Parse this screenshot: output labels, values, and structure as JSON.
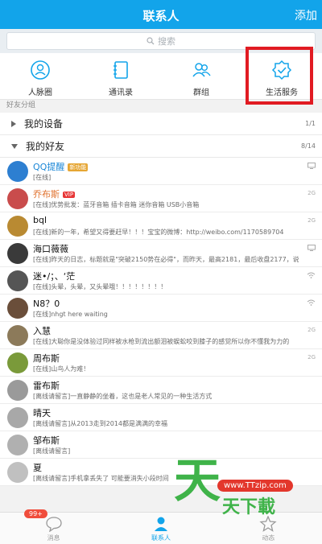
{
  "header": {
    "title": "联系人",
    "add_label": "添加"
  },
  "search": {
    "placeholder": "搜索"
  },
  "quick_entries": [
    {
      "label": "人脉圈",
      "icon": "people-circle-icon"
    },
    {
      "label": "通讯录",
      "icon": "address-book-icon"
    },
    {
      "label": "群组",
      "icon": "group-icon"
    },
    {
      "label": "生活服务",
      "icon": "shield-check-icon"
    }
  ],
  "group_label": "好友分组",
  "sections": [
    {
      "name": "我的设备",
      "count": "1/1",
      "expanded": false
    },
    {
      "name": "我的好友",
      "count": "8/14",
      "expanded": true
    }
  ],
  "contacts": [
    {
      "name": "QQ提醒",
      "badge": "新功能",
      "signature": "[在线]",
      "status": "pc",
      "avatar_color": "#2d7fd1"
    },
    {
      "name": "乔布斯",
      "badge": "VIP",
      "signature": "[在线]优势批发：蓝牙音箱 插卡音箱 迷你音箱 USB小音箱",
      "status": "2G",
      "avatar_color": "#c94c4c"
    },
    {
      "name": "bql",
      "badge": "",
      "signature": "[在线]新的一年，希望又得要赶早！！！宝宝的微博：http://weibo.com/1170589704",
      "status": "2G",
      "avatar_color": "#b98a32"
    },
    {
      "name": "海口薇薇",
      "badge": "",
      "signature": "[在线]昨天的日志，标题就是\"突破2150势在必得\"，而昨天，最高2181，最后收盘2177，说",
      "status": "pc",
      "avatar_color": "#3a3a3a"
    },
    {
      "name": "迷•/；、‘茫",
      "badge": "",
      "signature": "[在线]头晕，头晕，又头晕哦！！！！！！！！",
      "status": "wifi",
      "avatar_color": "#555"
    },
    {
      "name": "N8？0",
      "badge": "",
      "signature": "[在线]nhgt here waiting",
      "status": "wifi",
      "avatar_color": "#6a4e3a"
    },
    {
      "name": "入慧",
      "badge": "",
      "signature": "[在线]大聪你是没体验过同样被水枪到流出额泪被蜈蚣咬到膝子的感觉所以你不懂我为力的",
      "status": "2G",
      "avatar_color": "#8c7a5a"
    },
    {
      "name": "周布斯",
      "badge": "",
      "signature": "[在线]山鸟人为难！",
      "status": "2G",
      "avatar_color": "#7a9a3a"
    },
    {
      "name": "雷布斯",
      "badge": "",
      "signature": "[离线请留言]一直静静的坐着，这也是老人常见的一种生活方式",
      "status": "",
      "avatar_color": "#9a9a9a"
    },
    {
      "name": "晴天",
      "badge": "",
      "signature": "[离线请留言]从2013走到2014都是满满的幸福",
      "status": "",
      "avatar_color": "#a8a8a8"
    },
    {
      "name": "邹布斯",
      "badge": "",
      "signature": "[离线请留言]",
      "status": "",
      "avatar_color": "#b0b0b0"
    },
    {
      "name": "夏",
      "badge": "",
      "signature": "[离线请留言]手机拿丢失了  可能要消失小段时间",
      "status": "",
      "avatar_color": "#c0c0c0"
    }
  ],
  "tabs": [
    {
      "label": "消息",
      "badge": "99+",
      "active": false
    },
    {
      "label": "联系人",
      "badge": "",
      "active": true
    },
    {
      "label": "动态",
      "badge": "",
      "active": false
    }
  ],
  "watermark": {
    "glyph": "天",
    "url": "www.TTzip.com",
    "text": "天下載"
  },
  "colors": {
    "accent": "#12a4ea",
    "highlight": "#e11b22",
    "vip_name": "#e0702c"
  }
}
